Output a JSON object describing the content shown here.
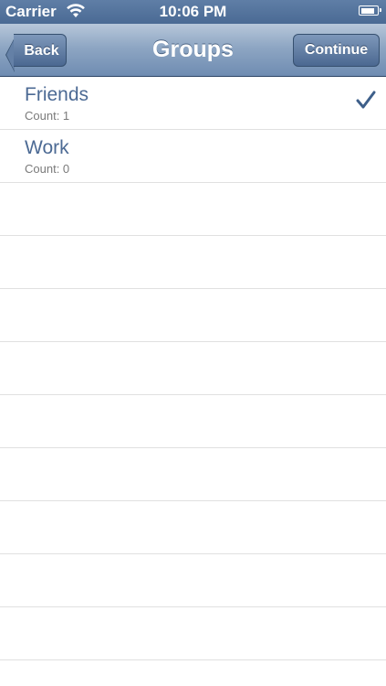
{
  "status_bar": {
    "carrier": "Carrier",
    "time": "10:06 PM",
    "wifi_icon": "wifi-icon",
    "battery_icon": "battery-icon",
    "battery_level": 0.9
  },
  "nav_bar": {
    "title": "Groups",
    "back_label": "Back",
    "continue_label": "Continue"
  },
  "groups": [
    {
      "name": "Friends",
      "count": "Count: 1",
      "selected": true
    },
    {
      "name": "Work",
      "count": "Count: 0",
      "selected": false
    }
  ],
  "colors": {
    "nav_tint": "#6f8cb2",
    "title_text": "#4c6a94",
    "checkmark": "#3e5f8a"
  }
}
